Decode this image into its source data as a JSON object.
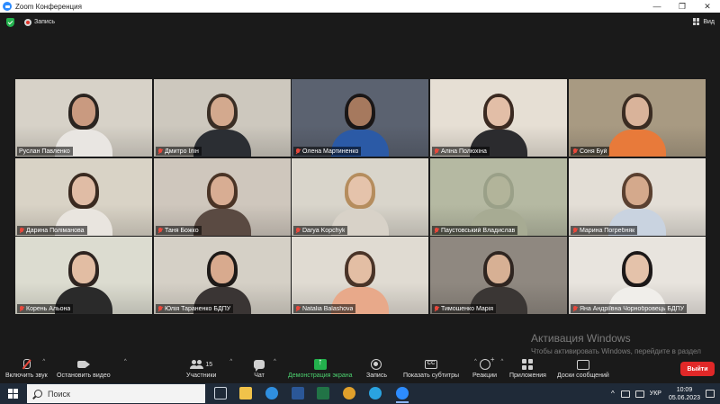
{
  "window": {
    "title": "Zoom Конференция",
    "controls": [
      "—",
      "❐",
      "✕"
    ]
  },
  "topbar": {
    "recording_label": "Запись",
    "view_label": "Вид"
  },
  "participants": [
    {
      "name": "Руслан Павленко",
      "active": true,
      "muted": false,
      "bg": "#d7d2c8",
      "skin": "#c99a80",
      "hair": "#2a2420",
      "shirt": "#e9e6e2"
    },
    {
      "name": "Дмитро Ілін",
      "active": false,
      "muted": true,
      "bg": "#cdc8be",
      "skin": "#d3a98e",
      "hair": "#3a2e25",
      "shirt": "#2b2e33"
    },
    {
      "name": "Олена Мартиненко",
      "active": false,
      "muted": true,
      "bg": "#5b6270",
      "skin": "#a6795e",
      "hair": "#1a1616",
      "shirt": "#2b5aa6"
    },
    {
      "name": "Аліна Полюхіна",
      "active": false,
      "muted": true,
      "bg": "#e6dfd4",
      "skin": "#e2bea7",
      "hair": "#3b2a21",
      "shirt": "#2b2b2e"
    },
    {
      "name": "Соня Буй",
      "active": false,
      "muted": true,
      "bg": "#a89a82",
      "skin": "#d9b39a",
      "hair": "#3a2c22",
      "shirt": "#e87a3a"
    },
    {
      "name": "Дарина Поліманова",
      "active": false,
      "muted": true,
      "bg": "#d9d3c6",
      "skin": "#e0bca5",
      "hair": "#3a2a20",
      "shirt": "#e9e5df"
    },
    {
      "name": "Таня Божко",
      "active": false,
      "muted": true,
      "bg": "#cfc7bd",
      "skin": "#d8ad93",
      "hair": "#4a3426",
      "shirt": "#5a4a42"
    },
    {
      "name": "Darya Kopchyk",
      "active": false,
      "muted": true,
      "bg": "#d9d5cb",
      "skin": "#e5c3ab",
      "hair": "#b58d5e",
      "shirt": "#d8d2c8"
    },
    {
      "name": "Паустовський Владислав",
      "active": false,
      "muted": true,
      "bg": "#b5b9a2",
      "skin": "#b2b49a",
      "hair": "#9aa088",
      "shirt": "#a7ab93"
    },
    {
      "name": "Марина Погребняк",
      "active": false,
      "muted": true,
      "bg": "#e3ded6",
      "skin": "#d4a98c",
      "hair": "#5a4030",
      "shirt": "#c9d3e0"
    },
    {
      "name": "Корень Альона",
      "active": false,
      "muted": true,
      "bg": "#dcdcd0",
      "skin": "#e2bda3",
      "hair": "#2e2420",
      "shirt": "#2a2a2a"
    },
    {
      "name": "Юлія Тараненко БДПУ",
      "active": false,
      "muted": true,
      "bg": "#d5d0c6",
      "skin": "#d8aa8e",
      "hair": "#1e1a18",
      "shirt": "#3a3534"
    },
    {
      "name": "Natalia Balashova",
      "active": false,
      "muted": true,
      "bg": "#e0dbd2",
      "skin": "#e3bea4",
      "hair": "#4a3428",
      "shirt": "#e8a98a"
    },
    {
      "name": "Тимошенко Марія",
      "active": false,
      "muted": true,
      "bg": "#8f8880",
      "skin": "#d7b094",
      "hair": "#2f2520",
      "shirt": "#3a3634"
    },
    {
      "name": "Яна Андріївна Чорнобровець БДПУ",
      "active": false,
      "muted": true,
      "bg": "#e8e4de",
      "skin": "#e4c2aa",
      "hair": "#1c1818",
      "shirt": "#f0eeea"
    }
  ],
  "watermark": {
    "line1": "Активация Windows",
    "line2": "Чтобы активировать Windows, перейдите в раздел \"Параметры\"."
  },
  "toolbar": {
    "unmute_label": "Включить звук",
    "stop_video_label": "Остановить видео",
    "participants_label": "Участники",
    "participants_count": "15",
    "chat_label": "Чат",
    "share_label": "Демонстрация экрана",
    "record_label": "Запись",
    "captions_label": "Показать субтитры",
    "cc_glyph": "CC",
    "reactions_label": "Реакции",
    "apps_label": "Приложения",
    "whiteboards_label": "Доски сообщений",
    "leave_label": "Выйти"
  },
  "taskbar": {
    "search_label": "Поиск",
    "language": "УКР",
    "time": "10:09",
    "date": "05.06.2023",
    "apps": [
      {
        "name": "task-view-app",
        "color": "#cfd6df"
      },
      {
        "name": "file-explorer-app",
        "color": "#f0c24a"
      },
      {
        "name": "edge-app",
        "color": "#2f8fe0"
      },
      {
        "name": "word-app",
        "color": "#2b5797"
      },
      {
        "name": "excel-app",
        "color": "#217346"
      },
      {
        "name": "chrome-app",
        "color": "#e0a02b"
      },
      {
        "name": "telegram-app",
        "color": "#2aa3e0"
      },
      {
        "name": "zoom-app",
        "color": "#2d8cff"
      }
    ]
  },
  "colors": {
    "accent": "#2d8cff",
    "active_speaker": "#c7d93c",
    "share_green": "#23b14d",
    "leave_red": "#e02828",
    "muted_red": "#e8483c"
  }
}
